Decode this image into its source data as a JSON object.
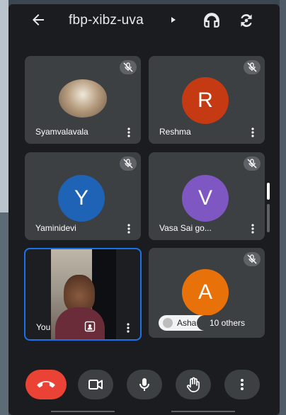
{
  "meeting": {
    "code": "fbp-xibz-uva"
  },
  "participants": [
    {
      "name": "Syamvalavala",
      "muted": true,
      "type": "photo"
    },
    {
      "name": "Reshma",
      "muted": true,
      "initial": "R",
      "color": "#c53a12"
    },
    {
      "name": "Yaminidevi",
      "muted": true,
      "initial": "Y",
      "color": "#1e63b6"
    },
    {
      "name": "Vasa Sai go...",
      "muted": true,
      "initial": "V",
      "color": "#7e57c2"
    },
    {
      "name": "You",
      "muted": false,
      "type": "video"
    },
    {
      "name": "Asha",
      "muted": true,
      "initial": "A",
      "color": "#e8710a"
    }
  ],
  "others_chip": {
    "name": "Asha",
    "label": "10 others"
  },
  "controls": [
    {
      "icon": "end-call-icon",
      "color": "#ea4335"
    },
    {
      "icon": "camera-icon"
    },
    {
      "icon": "mic-icon"
    },
    {
      "icon": "raise-hand-icon"
    },
    {
      "icon": "more-options-icon"
    }
  ],
  "colors": {
    "tile_bg": "#3c4043",
    "background": "#1b1c1f",
    "self_border": "#1a73e8"
  }
}
